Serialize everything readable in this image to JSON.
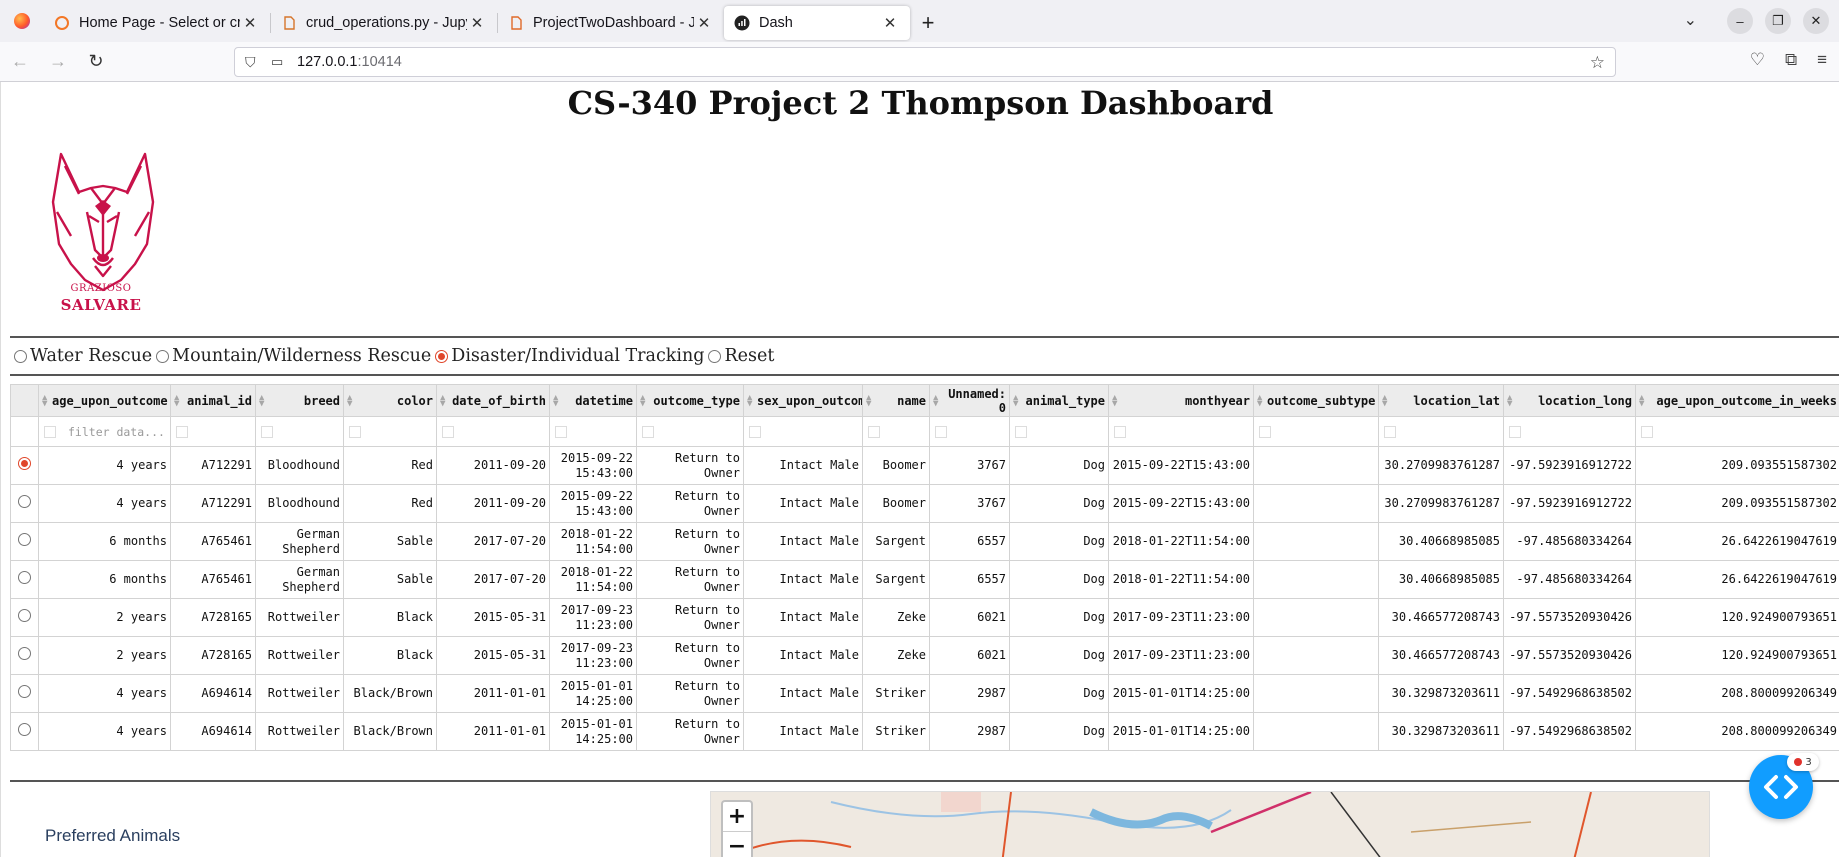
{
  "browser": {
    "tabs": [
      {
        "label": "Home Page - Select or cre",
        "icon": "jupyter-icon",
        "active": false
      },
      {
        "label": "crud_operations.py - Jupy",
        "icon": "file-icon",
        "active": false
      },
      {
        "label": "ProjectTwoDashboard - J",
        "icon": "notebook-icon",
        "active": false
      },
      {
        "label": "Dash",
        "icon": "dash-icon",
        "active": true
      }
    ],
    "url_host": "127.0.0.1",
    "url_port": ":10414"
  },
  "page": {
    "title": "CS-340 Project 2 Thompson Dashboard",
    "logo_line1": "GRAZIOSO",
    "logo_line2": "SALVARE",
    "brand_color": "#c8124a"
  },
  "filters": {
    "options": [
      {
        "label": "Water Rescue",
        "selected": false
      },
      {
        "label": "Mountain/Wilderness Rescue",
        "selected": false
      },
      {
        "label": "Disaster/Individual Tracking",
        "selected": true
      },
      {
        "label": "Reset",
        "selected": false
      }
    ]
  },
  "table": {
    "columns": [
      "age_upon_outcome",
      "animal_id",
      "breed",
      "color",
      "date_of_birth",
      "datetime",
      "outcome_type",
      "sex_upon_outcome",
      "name",
      "Unnamed: 0",
      "animal_type",
      "monthyear",
      "outcome_subtype",
      "location_lat",
      "location_long",
      "age_upon_outcome_in_weeks"
    ],
    "filter_placeholder": "filter data...",
    "rows": [
      {
        "selected": true,
        "cells": [
          "4 years",
          "A712291",
          "Bloodhound",
          "Red",
          "2011-09-20",
          "2015-09-22 15:43:00",
          "Return to Owner",
          "Intact Male",
          "Boomer",
          "3767",
          "Dog",
          "2015-09-22T15:43:00",
          "",
          "30.2709983761287",
          "-97.5923916912722",
          "209.093551587302"
        ]
      },
      {
        "selected": false,
        "cells": [
          "4 years",
          "A712291",
          "Bloodhound",
          "Red",
          "2011-09-20",
          "2015-09-22 15:43:00",
          "Return to Owner",
          "Intact Male",
          "Boomer",
          "3767",
          "Dog",
          "2015-09-22T15:43:00",
          "",
          "30.2709983761287",
          "-97.5923916912722",
          "209.093551587302"
        ]
      },
      {
        "selected": false,
        "cells": [
          "6 months",
          "A765461",
          "German Shepherd",
          "Sable",
          "2017-07-20",
          "2018-01-22 11:54:00",
          "Return to Owner",
          "Intact Male",
          "Sargent",
          "6557",
          "Dog",
          "2018-01-22T11:54:00",
          "",
          "30.40668985085",
          "-97.485680334264",
          "26.6422619047619"
        ]
      },
      {
        "selected": false,
        "cells": [
          "6 months",
          "A765461",
          "German Shepherd",
          "Sable",
          "2017-07-20",
          "2018-01-22 11:54:00",
          "Return to Owner",
          "Intact Male",
          "Sargent",
          "6557",
          "Dog",
          "2018-01-22T11:54:00",
          "",
          "30.40668985085",
          "-97.485680334264",
          "26.6422619047619"
        ]
      },
      {
        "selected": false,
        "cells": [
          "2 years",
          "A728165",
          "Rottweiler",
          "Black",
          "2015-05-31",
          "2017-09-23 11:23:00",
          "Return to Owner",
          "Intact Male",
          "Zeke",
          "6021",
          "Dog",
          "2017-09-23T11:23:00",
          "",
          "30.466577208743",
          "-97.5573520930426",
          "120.924900793651"
        ]
      },
      {
        "selected": false,
        "cells": [
          "2 years",
          "A728165",
          "Rottweiler",
          "Black",
          "2015-05-31",
          "2017-09-23 11:23:00",
          "Return to Owner",
          "Intact Male",
          "Zeke",
          "6021",
          "Dog",
          "2017-09-23T11:23:00",
          "",
          "30.466577208743",
          "-97.5573520930426",
          "120.924900793651"
        ]
      },
      {
        "selected": false,
        "cells": [
          "4 years",
          "A694614",
          "Rottweiler",
          "Black/Brown",
          "2011-01-01",
          "2015-01-01 14:25:00",
          "Return to Owner",
          "Intact Male",
          "Striker",
          "2987",
          "Dog",
          "2015-01-01T14:25:00",
          "",
          "30.329873203611",
          "-97.5492968638502",
          "208.800099206349"
        ]
      },
      {
        "selected": false,
        "cells": [
          "4 years",
          "A694614",
          "Rottweiler",
          "Black/Brown",
          "2011-01-01",
          "2015-01-01 14:25:00",
          "Return to Owner",
          "Intact Male",
          "Striker",
          "2987",
          "Dog",
          "2015-01-01T14:25:00",
          "",
          "30.329873203611",
          "-97.5492968638502",
          "208.800099206349"
        ]
      }
    ]
  },
  "bottom": {
    "pie_title": "Preferred Animals",
    "zoom_in": "+",
    "zoom_out": "−",
    "debug_badge_count": "3"
  }
}
